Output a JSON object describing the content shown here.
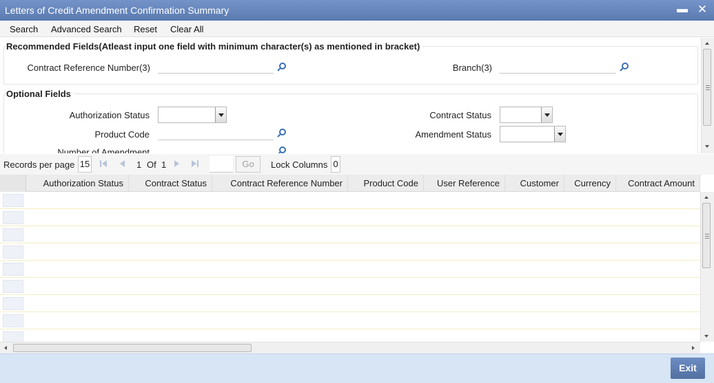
{
  "window": {
    "title": "Letters of Credit Amendment Confirmation Summary"
  },
  "toolbar": {
    "search": "Search",
    "advanced_search": "Advanced Search",
    "reset": "Reset",
    "clear_all": "Clear All"
  },
  "recommended": {
    "legend": "Recommended Fields(Atleast input one field with minimum character(s) as mentioned in bracket)",
    "contract_ref_label": "Contract Reference Number(3)",
    "contract_ref_value": "",
    "branch_label": "Branch(3)",
    "branch_value": ""
  },
  "optional": {
    "legend": "Optional Fields",
    "auth_status_label": "Authorization Status",
    "auth_status_value": "",
    "contract_status_label": "Contract Status",
    "contract_status_value": "",
    "product_code_label": "Product Code",
    "product_code_value": "",
    "amendment_status_label": "Amendment Status",
    "amendment_status_value": "",
    "num_amendment_label": "Number of Amendment"
  },
  "pager": {
    "records_per_page_label": "Records per page",
    "records_per_page": "15",
    "current_page": "1",
    "of_label": "Of",
    "total_pages": "1",
    "go_label": "Go",
    "lock_columns_label": "Lock Columns",
    "lock_columns": "0"
  },
  "grid": {
    "columns": [
      "Authorization Status",
      "Contract Status",
      "Contract Reference Number",
      "Product Code",
      "User Reference",
      "Customer",
      "Currency",
      "Contract Amount"
    ],
    "rows": []
  },
  "footer": {
    "exit": "Exit"
  },
  "icons": {
    "lookup": "search-icon",
    "close": "close-icon",
    "minimize": "minimize-icon"
  },
  "colors": {
    "titlebar": "#6583b8",
    "footer": "#d7e5f5",
    "accent": "#5d7cb4"
  }
}
